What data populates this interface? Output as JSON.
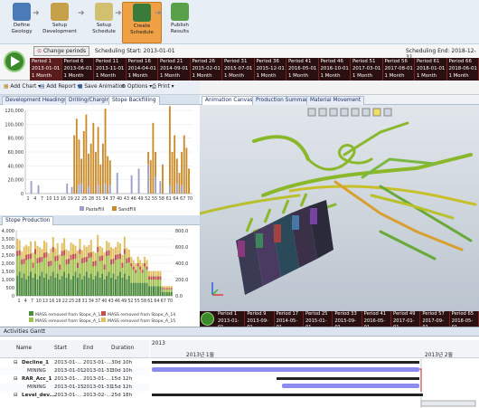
{
  "toolbar": {
    "steps": [
      {
        "label_1": "Define",
        "label_2": "Geology",
        "color": "#4a7ab8"
      },
      {
        "label_1": "Setup",
        "label_2": "Development",
        "color": "#c7a04a"
      },
      {
        "label_1": "Setup",
        "label_2": "Schedule",
        "color": "#d0c070"
      },
      {
        "label_1": "Create",
        "label_2": "Schedule",
        "color": "#3a7a3a"
      },
      {
        "label_1": "Publish",
        "label_2": "Results",
        "color": "#5aa04a"
      }
    ]
  },
  "periods": {
    "change_label": "Change periods",
    "start": "Scheduling Start: 2013-01-01",
    "end": "Scheduling End: 2018-12-31",
    "cells": [
      {
        "name": "Period 1",
        "date": "2013-01-01",
        "dur": "1 Month"
      },
      {
        "name": "Period 6",
        "date": "2013-06-01",
        "dur": "1 Month"
      },
      {
        "name": "Period 11",
        "date": "2013-11-01",
        "dur": "1 Month"
      },
      {
        "name": "Period 16",
        "date": "2014-04-01",
        "dur": "1 Month"
      },
      {
        "name": "Period 21",
        "date": "2014-09-01",
        "dur": "1 Month"
      },
      {
        "name": "Period 26",
        "date": "2015-02-01",
        "dur": "1 Month"
      },
      {
        "name": "Period 31",
        "date": "2015-07-01",
        "dur": "1 Month"
      },
      {
        "name": "Period 36",
        "date": "2015-12-01",
        "dur": "1 Month"
      },
      {
        "name": "Period 41",
        "date": "2016-05-01",
        "dur": "1 Month"
      },
      {
        "name": "Period 46",
        "date": "2016-10-01",
        "dur": "1 Month"
      },
      {
        "name": "Period 51",
        "date": "2017-03-01",
        "dur": "1 Month"
      },
      {
        "name": "Period 56",
        "date": "2017-08-01",
        "dur": "1 Month"
      },
      {
        "name": "Period 61",
        "date": "2018-01-01",
        "dur": "1 Month"
      },
      {
        "name": "Period 66",
        "date": "2018-06-01",
        "dur": "1 Month"
      }
    ]
  },
  "commands": {
    "add_chart": "Add Chart",
    "add_report": "Add Report",
    "save_animation": "Save Animation",
    "options": "Options",
    "print": "Print"
  },
  "left_tabs": [
    "Development Headings",
    "Drilling/Charging",
    "Stope Backfilling"
  ],
  "right_tabs": [
    "Animation Canvas",
    "Production Summary",
    "Material Movement"
  ],
  "chart_data": [
    {
      "type": "bar",
      "title": "",
      "ylim": [
        0,
        130000
      ],
      "yticks": [
        "120,000",
        "100,000",
        "80,000",
        "60,000",
        "40,000",
        "20,000",
        "0"
      ],
      "xticks": [
        "1",
        "4",
        "7",
        "10",
        "13",
        "16",
        "19",
        "22",
        "25",
        "28",
        "31",
        "34",
        "37",
        "40",
        "43",
        "46",
        "49",
        "52",
        "55",
        "58",
        "61",
        "64",
        "67",
        "70"
      ],
      "series": [
        {
          "name": "PasteFill",
          "color": "#9aa0c8"
        },
        {
          "name": "SandFill",
          "color": "#c98a2a"
        }
      ],
      "legend": "bottom"
    },
    {
      "type": "bar",
      "title": "Stope Production",
      "ylim": [
        0,
        4000
      ],
      "yticks": [
        "4,000",
        "3,500",
        "3,000",
        "2,500",
        "2,000",
        "1,500",
        "1,000",
        "500",
        "0"
      ],
      "y2ticks": [
        "800.0",
        "600.0",
        "400.0",
        "200.0",
        "0.0"
      ],
      "xticks": [
        "1",
        "4",
        "7",
        "10",
        "13",
        "16",
        "19",
        "22",
        "25",
        "28",
        "31",
        "34",
        "37",
        "40",
        "43",
        "46",
        "49",
        "52",
        "55",
        "58",
        "61",
        "64",
        "67",
        "70"
      ],
      "series": [
        {
          "name": "MASS removed from Stope_A_12",
          "color": "#4a8a3a"
        },
        {
          "name": "MASS removed from Stope_A_13",
          "color": "#a0c050"
        },
        {
          "name": "MASS removed from Stope_A_14",
          "color": "#c05050"
        },
        {
          "name": "MASS removed from Stope_A_15",
          "color": "#e0c060"
        }
      ],
      "legend": "bottom"
    }
  ],
  "canvas": {
    "timeline": [
      {
        "name": "Period 1",
        "date": "2013-01-01"
      },
      {
        "name": "Period 9",
        "date": "2013-09-01"
      },
      {
        "name": "Period 17",
        "date": "2014-05-01"
      },
      {
        "name": "Period 25",
        "date": "2015-01-01"
      },
      {
        "name": "Period 33",
        "date": "2015-09-01"
      },
      {
        "name": "Period 41",
        "date": "2016-05-01"
      },
      {
        "name": "Period 49",
        "date": "2017-01-01"
      },
      {
        "name": "Period 57",
        "date": "2017-09-01"
      },
      {
        "name": "Period 65",
        "date": "2018-05-01"
      }
    ]
  },
  "gantt": {
    "title": "Activities Gantt",
    "columns": [
      "Name",
      "Start",
      "End",
      "Duration"
    ],
    "year": "2013",
    "month_1": "2013년 1월",
    "month_2": "2013년 2월",
    "rows": [
      {
        "name": "Decline_1",
        "start": "2013-01-...",
        "end": "2013-01-...",
        "dur": "30d 10h",
        "level": 0
      },
      {
        "name": "MINING",
        "start": "2013-01-01",
        "end": "2013-01-31",
        "dur": "30d 10h",
        "level": 1
      },
      {
        "name": "RAR_Acc_1",
        "start": "2013-01-...",
        "end": "2013-01-...",
        "dur": "15d 12h",
        "level": 0
      },
      {
        "name": "MINING",
        "start": "2013-01-15",
        "end": "2013-01-31",
        "dur": "15d 12h",
        "level": 1
      },
      {
        "name": "Level_dev...",
        "start": "2013-01-...",
        "end": "2013-02-...",
        "dur": "25d 18h",
        "level": 0
      }
    ]
  }
}
